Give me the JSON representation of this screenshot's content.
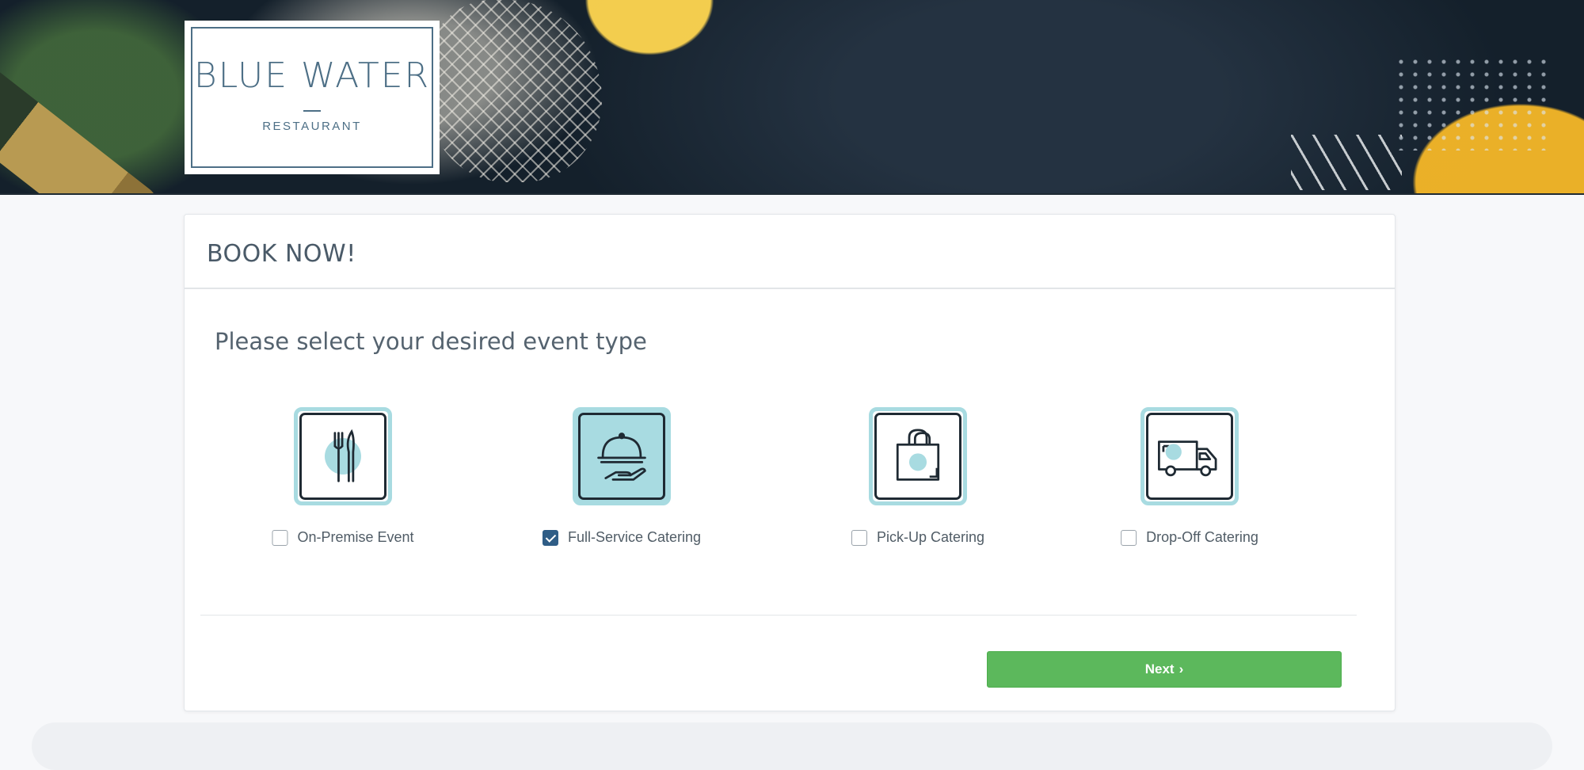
{
  "brand": {
    "name": "BLUE WATER",
    "tagline": "RESTAURANT"
  },
  "card": {
    "title": "BOOK NOW!",
    "prompt": "Please select your desired event type"
  },
  "options": [
    {
      "label": "On-Premise Event",
      "icon": "fork-knife-icon",
      "checked": false
    },
    {
      "label": "Full-Service Catering",
      "icon": "serving-cloche-icon",
      "checked": true
    },
    {
      "label": "Pick-Up Catering",
      "icon": "shopping-bag-icon",
      "checked": false
    },
    {
      "label": "Drop-Off Catering",
      "icon": "delivery-truck-icon",
      "checked": false
    }
  ],
  "next_button": {
    "label": "Next",
    "icon": "chevron-right-icon"
  },
  "colors": {
    "accent": "#a8dbe1",
    "brand_blue": "#4d6f86",
    "next_green": "#5cb85c",
    "checked_blue": "#2f5d86"
  }
}
